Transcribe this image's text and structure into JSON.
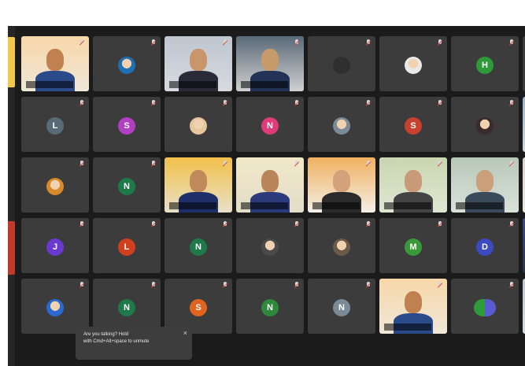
{
  "tooltip": {
    "line1": "Are you talking? Hold ",
    "line2": "with Cmd+Alt+space to unmute"
  },
  "participants": [
    {
      "name": "",
      "type": "video",
      "speaking": false
    },
    {
      "name": "",
      "type": "avatar",
      "kind": "photo",
      "color": "#1f6fb5"
    },
    {
      "name": "",
      "type": "video",
      "speaking": false
    },
    {
      "name": "",
      "type": "video",
      "speaking": true
    },
    {
      "name": "",
      "type": "avatar",
      "kind": "dot",
      "color": "#2f2f2f"
    },
    {
      "name": "",
      "type": "avatar",
      "kind": "photo",
      "color": "#e8e8e8"
    },
    {
      "name": "",
      "type": "avatar",
      "initial": "H",
      "color": "#2e9a3a"
    },
    {
      "name": "",
      "type": "avatar",
      "kind": "photo",
      "color": "#d9d9d9"
    },
    {
      "name": "",
      "type": "avatar",
      "initial": "L",
      "color": "#5a6b78"
    },
    {
      "name": "",
      "type": "avatar",
      "initial": "S",
      "color": "#b040c0"
    },
    {
      "name": "",
      "type": "avatar",
      "kind": "photo",
      "color": "#e6c7a0"
    },
    {
      "name": "",
      "type": "avatar",
      "initial": "N",
      "color": "#e03a7a"
    },
    {
      "name": "",
      "type": "avatar",
      "kind": "photo",
      "color": "#7a8a96"
    },
    {
      "name": "",
      "type": "avatar",
      "initial": "S",
      "color": "#c8402e"
    },
    {
      "name": "",
      "type": "avatar",
      "kind": "photo",
      "color": "#3a2a2a"
    },
    {
      "name": "",
      "type": "video",
      "speaking": false
    },
    {
      "name": "",
      "type": "avatar",
      "kind": "photo",
      "color": "#d88a2a"
    },
    {
      "name": "",
      "type": "avatar",
      "initial": "N",
      "color": "#1f7a4a"
    },
    {
      "name": "",
      "type": "video",
      "speaking": false
    },
    {
      "name": "",
      "type": "video",
      "speaking": false
    },
    {
      "name": "",
      "type": "video",
      "speaking": false
    },
    {
      "name": "",
      "type": "video",
      "speaking": false
    },
    {
      "name": "",
      "type": "video",
      "speaking": false
    },
    {
      "name": "",
      "type": "video",
      "speaking": false
    },
    {
      "name": "",
      "type": "avatar",
      "initial": "J",
      "color": "#6a3ad0"
    },
    {
      "name": "",
      "type": "avatar",
      "initial": "L",
      "color": "#d0401e"
    },
    {
      "name": "",
      "type": "avatar",
      "initial": "N",
      "color": "#1f7a4a"
    },
    {
      "name": "",
      "type": "avatar",
      "kind": "photo",
      "color": "#4a4a4a"
    },
    {
      "name": "",
      "type": "avatar",
      "kind": "photo",
      "color": "#6a5a4a"
    },
    {
      "name": "",
      "type": "avatar",
      "initial": "M",
      "color": "#3a9a3a"
    },
    {
      "name": "",
      "type": "avatar",
      "initial": "D",
      "color": "#3a4ac0"
    },
    {
      "name": "",
      "type": "video",
      "speaking": false
    },
    {
      "name": "",
      "type": "avatar",
      "kind": "photo",
      "color": "#2a6ad0"
    },
    {
      "name": "",
      "type": "avatar",
      "initial": "N",
      "color": "#1f7a4a"
    },
    {
      "name": "",
      "type": "avatar",
      "initial": "S",
      "color": "#e0641e"
    },
    {
      "name": "",
      "type": "avatar",
      "initial": "N",
      "color": "#2e8a3a"
    },
    {
      "name": "",
      "type": "avatar",
      "initial": "N",
      "color": "#7a8a96"
    },
    {
      "name": "",
      "type": "video",
      "speaking": false
    },
    {
      "name": "",
      "type": "avatar",
      "kind": "duo",
      "color": "#2e9a3a"
    },
    {
      "name": "",
      "type": "video",
      "speaking": false
    }
  ]
}
